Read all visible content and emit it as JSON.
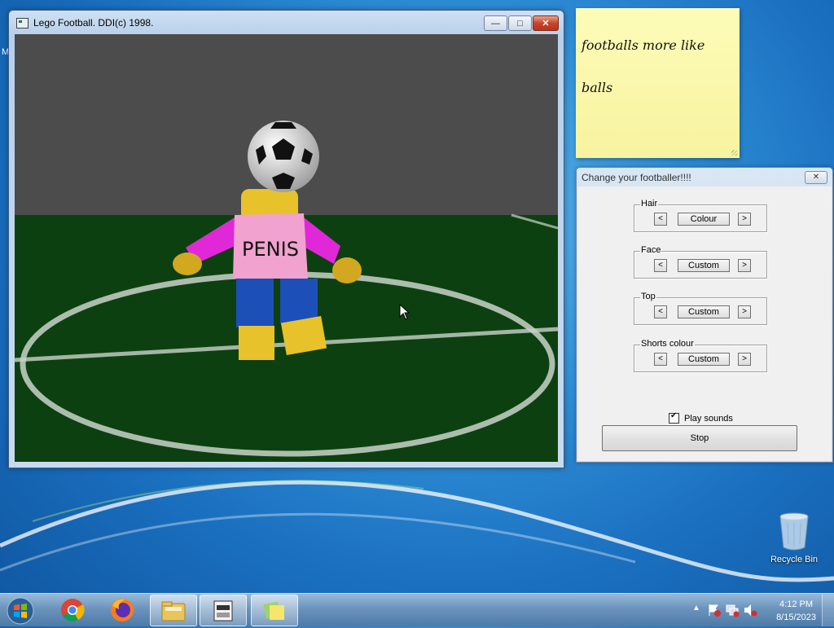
{
  "desktop": {
    "stray_text": "M"
  },
  "game_window": {
    "title": "Lego Football.  DDI(c) 1998.",
    "caption_buttons": {
      "minimize": "—",
      "maximize": "□",
      "close": "✕"
    },
    "shirt_text": "PENIS"
  },
  "sticky_note": {
    "lines": [
      "footballs more like",
      "balls"
    ],
    "color": "#fbf8b0"
  },
  "dialog": {
    "title": "Change your footballer!!!!",
    "close_label": "✕",
    "groups": [
      {
        "label": "Hair",
        "value": "Colour",
        "prev": "<",
        "next": ">"
      },
      {
        "label": "Face",
        "value": "Custom",
        "prev": "<",
        "next": ">"
      },
      {
        "label": "Top",
        "value": "Custom",
        "prev": "<",
        "next": ">"
      },
      {
        "label": "Shorts colour",
        "value": "Custom",
        "prev": "<",
        "next": ">"
      }
    ],
    "play_sounds": {
      "label": "Play sounds",
      "checked": true
    },
    "stop_label": "Stop"
  },
  "recycle_bin": {
    "label": "Recycle Bin"
  },
  "taskbar": {
    "pinned": [
      "chrome-icon",
      "firefox-icon",
      "explorer-icon",
      "lego-football-icon",
      "sticky-notes-icon"
    ],
    "clock": {
      "time": "4:12 PM",
      "date": "8/15/2023"
    }
  }
}
